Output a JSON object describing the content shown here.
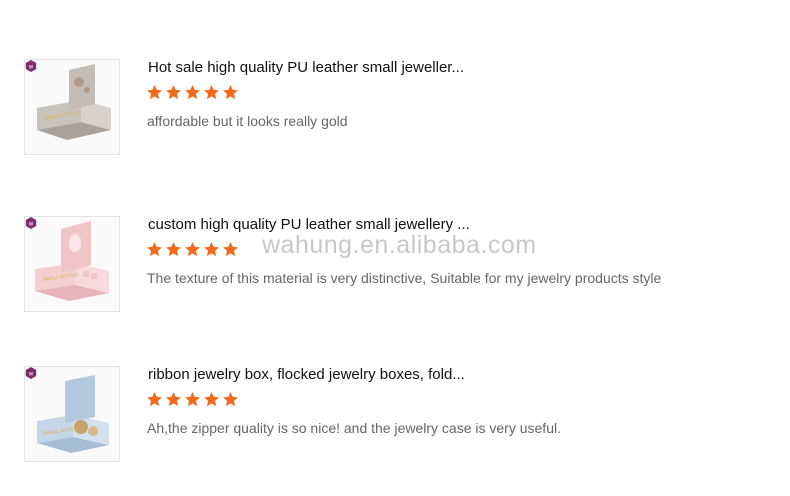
{
  "watermark": "wahung.en.alibaba.com",
  "colors": {
    "star": "#f26a1b",
    "badge": "#7b2d6b"
  },
  "reviews": [
    {
      "title": "Hot sale high quality PU leather small jeweller...",
      "rating": 5,
      "comment": "affordable but it looks really gold",
      "thumbnail": "grey-jewelry-box",
      "box_color": "#b7b1ac"
    },
    {
      "title": "custom high quality PU leather small jewellery ...",
      "rating": 5,
      "comment": "The texture of this material is very distinctive, Suitable for my jewelry products style",
      "thumbnail": "pink-jewelry-box",
      "box_color": "#f2c9cd"
    },
    {
      "title": "ribbon jewelry box, flocked jewelry boxes, fold...",
      "rating": 5,
      "comment": "Ah,the zipper quality is so nice!  and the jewelry case is very useful.",
      "thumbnail": "blue-jewelry-box",
      "box_color": "#b9cde1"
    }
  ]
}
